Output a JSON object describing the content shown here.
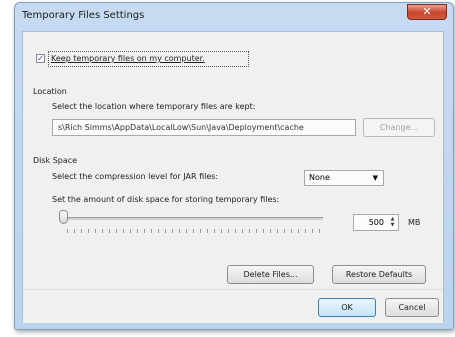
{
  "window": {
    "title": "Temporary Files Settings",
    "close_glyph": "✕"
  },
  "keep_files": {
    "label": "Keep temporary files on my computer.",
    "checked": true,
    "check_glyph": "✓"
  },
  "location": {
    "heading": "Location",
    "description": "Select the location where temporary files are kept:",
    "path": "s\\Rich Simms\\AppData\\LocalLow\\Sun\\Java\\Deployment\\cache",
    "change_button": "Change..."
  },
  "disk_space": {
    "heading": "Disk Space",
    "compression_label": "Select the compression level for JAR files:",
    "compression_value": "None",
    "amount_label": "Set the amount of disk space for storing temporary files:",
    "amount_value": "500",
    "amount_unit": "MB",
    "slider_level": 0.0
  },
  "buttons": {
    "delete_files": "Delete Files...",
    "restore_defaults": "Restore Defaults",
    "ok": "OK",
    "cancel": "Cancel"
  },
  "icons": {
    "dropdown_arrow": "▼",
    "spin_up": "▲",
    "spin_down": "▼"
  },
  "colors": {
    "titlebar": "#c6dbf2",
    "close_button": "#c7452b",
    "dialog_body": "#f0f0f0",
    "ok_button_accent": "#3c7fb1"
  }
}
